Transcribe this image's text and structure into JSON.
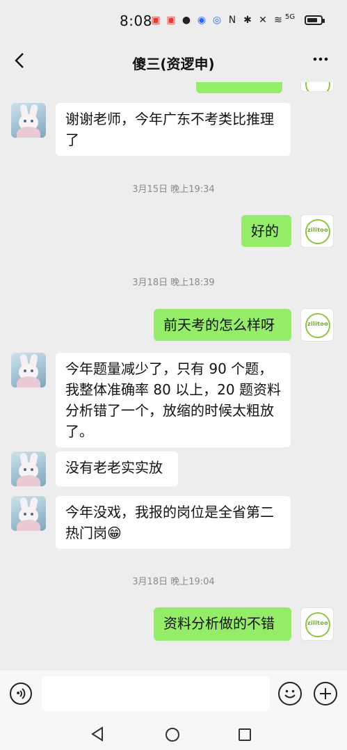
{
  "status_bar": {
    "time": "8:08",
    "network": "5G",
    "battery_percent": 80
  },
  "header": {
    "title": "傻三(资逻申)",
    "back_icon": "chevron-left-icon",
    "more_icon": "more-icon"
  },
  "messages": [
    {
      "side": "left",
      "text": "谢谢老师，今年广东不考类比推理了"
    },
    {
      "type": "timestamp",
      "text": "3月15日 晚上19:34"
    },
    {
      "side": "right",
      "text": "好的"
    },
    {
      "type": "timestamp",
      "text": "3月18日 晚上18:39"
    },
    {
      "side": "right",
      "text": "前天考的怎么样呀"
    },
    {
      "side": "left",
      "text": "今年题量减少了，只有 90 个题，我整体准确率 80 以上，20 题资料分析错了一个，放缩的时候太粗放了。"
    },
    {
      "side": "left",
      "text": "没有老老实实放"
    },
    {
      "side": "left",
      "text": "今年没戏，我报的岗位是全省第二热门岗😁"
    },
    {
      "type": "timestamp",
      "text": "3月18日 晚上19:04"
    },
    {
      "side": "right",
      "text": "资料分析做的不错"
    }
  ],
  "self_avatar_logo": "zilitoo",
  "input_bar": {
    "voice_icon": "voice-icon",
    "emoji_icon": "emoji-icon",
    "plus_icon": "plus-icon",
    "input_value": ""
  },
  "nav_bar": {
    "back_icon": "nav-back-icon",
    "home_icon": "nav-home-icon",
    "recent_icon": "nav-recent-icon"
  }
}
